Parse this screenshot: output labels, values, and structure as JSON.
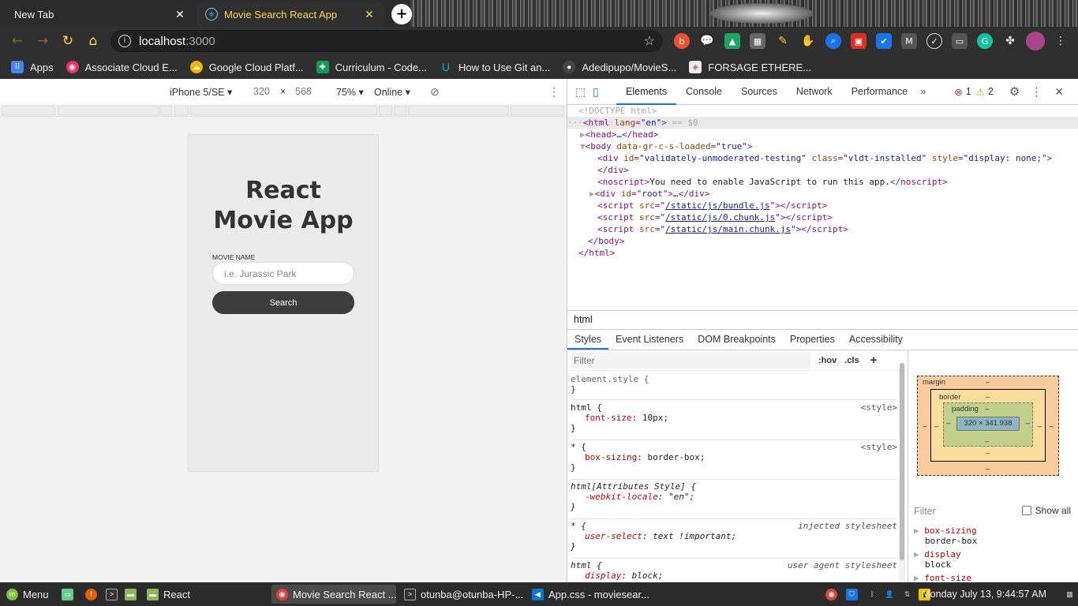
{
  "browser": {
    "tabs": [
      {
        "title": "New Tab",
        "active": false
      },
      {
        "title": "Movie Search React App",
        "active": true
      }
    ],
    "address": {
      "host": "localhost",
      "port": ":3000"
    },
    "bookmarks": [
      {
        "label": "Apps",
        "icon": "apps-grid-icon"
      },
      {
        "label": "Associate Cloud E...",
        "icon": "cloud-icon"
      },
      {
        "label": "Google Cloud Platf...",
        "icon": "google-cloud-icon"
      },
      {
        "label": "Curriculum - Code...",
        "icon": "sheets-icon"
      },
      {
        "label": "How to Use Git an...",
        "icon": "udacity-icon"
      },
      {
        "label": "Adedipupo/MovieS...",
        "icon": "github-icon"
      },
      {
        "label": "FORSAGE ETHERE...",
        "icon": "forsage-icon"
      }
    ]
  },
  "device_toolbar": {
    "device": "iPhone 5/SE",
    "width": "320",
    "times": "×",
    "height": "568",
    "zoom": "75%",
    "network": "Online"
  },
  "app": {
    "title_line1": "React",
    "title_line2": "Movie App",
    "movie_label": "MOVIE NAME",
    "input_placeholder": "i.e. Jurassic Park",
    "search_label": "Search"
  },
  "devtools": {
    "tabs": [
      "Elements",
      "Console",
      "Sources",
      "Network",
      "Performance"
    ],
    "errors": "1",
    "warnings": "2",
    "breadcrumb": "html",
    "subtabs": [
      "Styles",
      "Event Listeners",
      "DOM Breakpoints",
      "Properties",
      "Accessibility"
    ],
    "filter_placeholder": "Filter",
    "hov": ":hov",
    "cls": ".cls",
    "box_margin": "margin",
    "box_border": "border",
    "box_padding": "padding",
    "box_content": "320 × 341.938",
    "dash": "–",
    "computed_filter": "Filter",
    "show_all": "Show all",
    "computed": [
      {
        "name": "box-sizing",
        "value": "border-box"
      },
      {
        "name": "display",
        "value": "block"
      },
      {
        "name": "font-size",
        "value": ""
      }
    ]
  },
  "taskbar": {
    "menu": "Menu",
    "items": [
      "React",
      "Movie Search React ...",
      "otunba@otunba-HP-...",
      "App.css - moviesear..."
    ],
    "clock": "Monday July 13,  9:44:57 AM"
  }
}
